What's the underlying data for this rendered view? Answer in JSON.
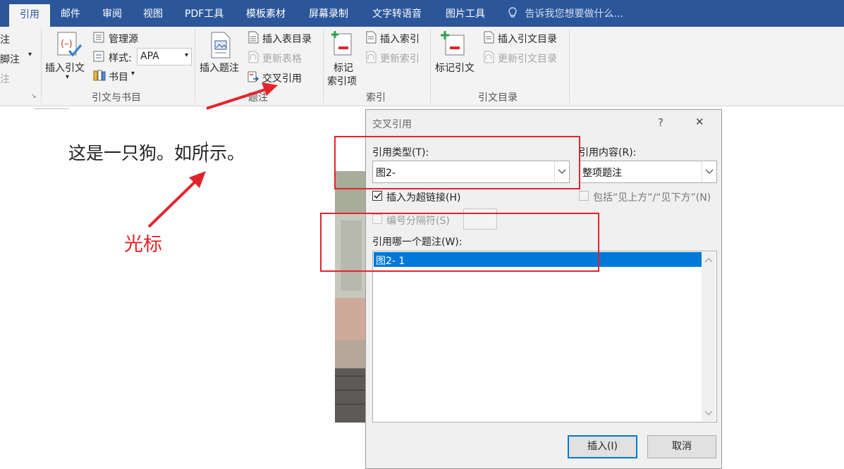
{
  "tabs": {
    "active": "引用",
    "items": [
      "邮件",
      "审阅",
      "视图",
      "PDF工具",
      "模板素材",
      "屏幕录制",
      "文字转语音",
      "图片工具"
    ],
    "tell_me": "告诉我您想要做什么..."
  },
  "ribbon": {
    "partial_left": [
      "注",
      "脚注",
      "注"
    ],
    "insert_citation": "插入引文",
    "manage_sources": "管理源",
    "style_label": "样式:",
    "style_value": "APA",
    "bibliography": "书目",
    "group_citations": "引文与书目",
    "insert_caption": "插入题注",
    "insert_table_of_figures": "插入表目录",
    "update_table": "更新表格",
    "cross_reference": "交叉引用",
    "group_captions": "题注",
    "mark_entry": "标记",
    "mark_entry_2": "索引项",
    "insert_index": "插入索引",
    "update_index": "更新索引",
    "group_index": "索引",
    "mark_citation": "标记引文",
    "insert_table_of_authorities": "插入引文目录",
    "update_table_of_authorities": "更新引文目录",
    "group_authorities": "引文目录"
  },
  "document": {
    "text": "这是一只狗。如所示。",
    "annotation": "光标"
  },
  "dialog": {
    "title": "交叉引用",
    "help": "?",
    "close": "✕",
    "reference_type_label": "引用类型(T):",
    "reference_type_value": "图2-",
    "insert_reference_to_label": "引用内容(R):",
    "insert_reference_to_value": "整项题注",
    "insert_as_hyperlink": "插入为超链接(H)",
    "insert_as_hyperlink_checked": true,
    "include_above_below": "包括“见上方”/“见下方”(N)",
    "separate_numbers": "编号分隔符(S)",
    "for_which_caption_label": "引用哪一个题注(W):",
    "captions": [
      "图2- 1"
    ],
    "insert_button": "插入(I)",
    "cancel_button": "取消"
  },
  "colors": {
    "brand": "#2b579a",
    "selection": "#0078d7",
    "annotation_red": "#e3242b"
  }
}
